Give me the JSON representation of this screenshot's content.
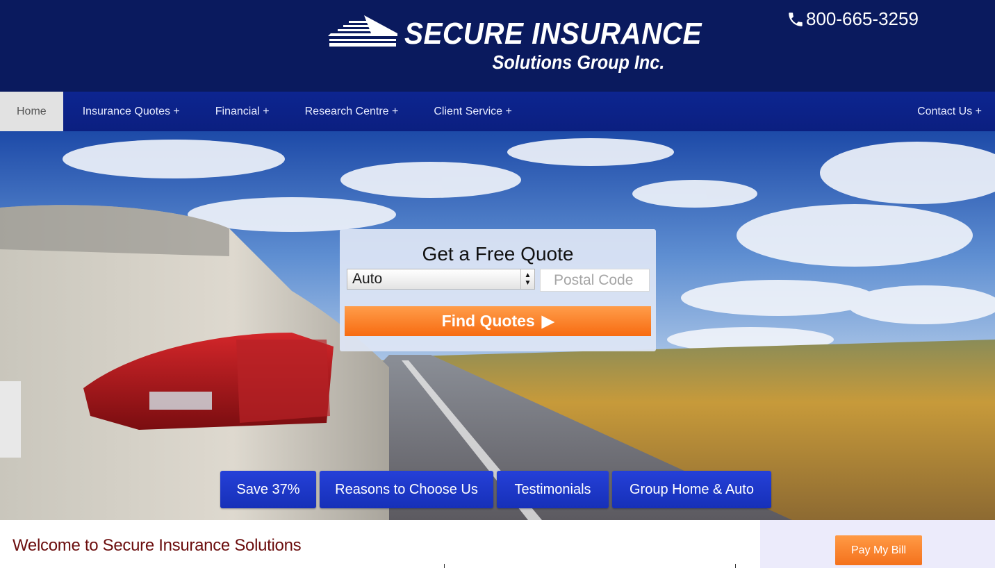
{
  "header": {
    "logo_title": "SECURE INSURANCE",
    "logo_subtitle": "Solutions Group Inc.",
    "phone": "800-665-3259"
  },
  "nav": {
    "items": [
      {
        "label": "Home"
      },
      {
        "label": "Insurance Quotes +"
      },
      {
        "label": "Financial +"
      },
      {
        "label": "Research Centre +"
      },
      {
        "label": "Client Service +"
      }
    ],
    "contact": "Contact Us +"
  },
  "quote": {
    "title": "Get a Free Quote",
    "selected_type": "Auto",
    "postal_placeholder": "Postal Code",
    "button_label": "Find Quotes"
  },
  "hero_buttons": [
    {
      "label": "Save 37%"
    },
    {
      "label": "Reasons to Choose Us"
    },
    {
      "label": "Testimonials"
    },
    {
      "label": "Group Home & Auto"
    }
  ],
  "content": {
    "welcome": "Welcome to Secure Insurance Solutions",
    "pay_bill": "Pay My Bill"
  },
  "colors": {
    "header_bg": "#0a1a5e",
    "nav_bg": "#0d2590",
    "accent_orange": "#f76b11",
    "hero_button_blue": "#1f3acb",
    "welcome_text": "#6b0d0d"
  }
}
